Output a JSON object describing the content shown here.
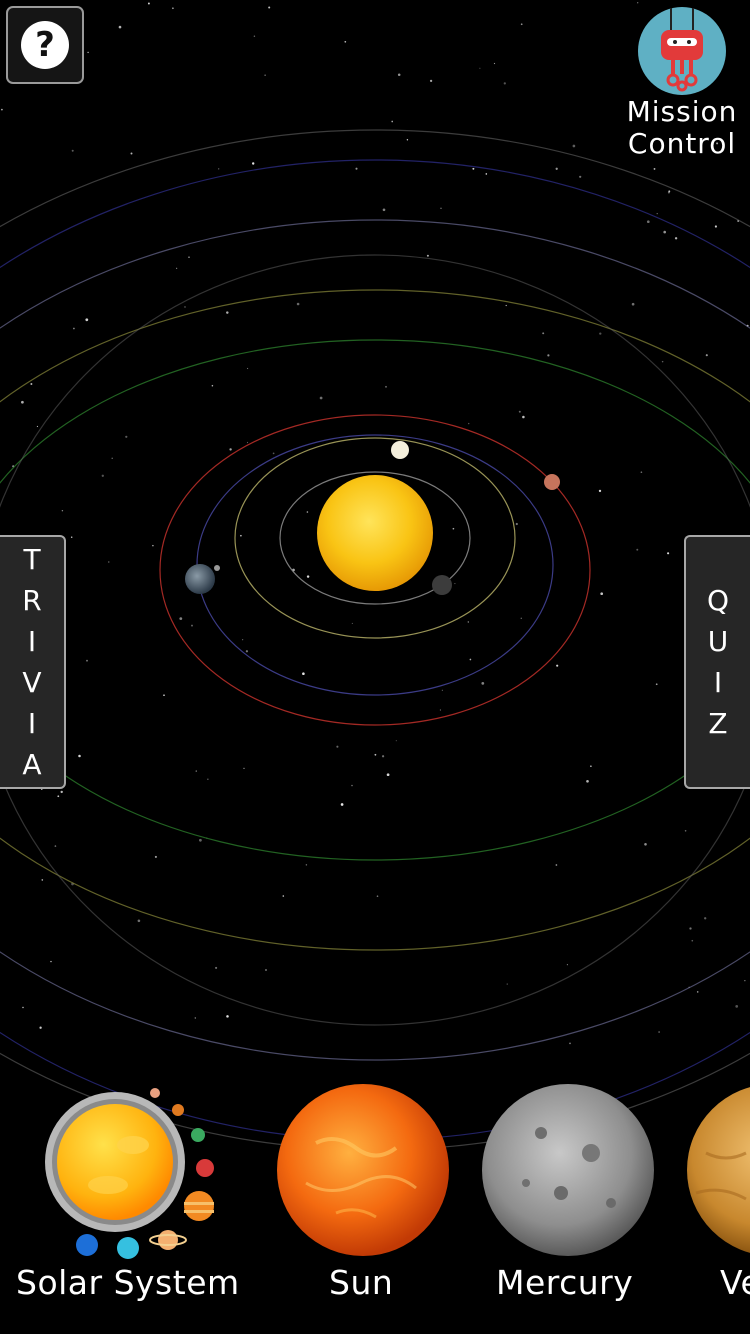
{
  "header": {
    "help_icon_glyph": "?",
    "mission_control_label_line1": "Mission",
    "mission_control_label_line2": "Control"
  },
  "side_tabs": {
    "trivia_letters": [
      "T",
      "R",
      "I",
      "V",
      "I",
      "A"
    ],
    "quiz_letters": [
      "Q",
      "U",
      "I",
      "Z"
    ]
  },
  "carousel": {
    "items": [
      {
        "name": "Solar System",
        "icon": "solar-system-icon"
      },
      {
        "name": "Sun",
        "icon": "sun-icon"
      },
      {
        "name": "Mercury",
        "icon": "mercury-icon"
      },
      {
        "name": "Ve",
        "icon": "venus-icon"
      }
    ]
  },
  "colors": {
    "background": "#000000",
    "tab_background": "#262626",
    "tab_border": "#a8a8a8",
    "sun": "#f7c21a",
    "orbit_mars": "#c0302a",
    "orbit_earth": "#4a4aa8",
    "orbit_venus": "#d9d27a"
  }
}
